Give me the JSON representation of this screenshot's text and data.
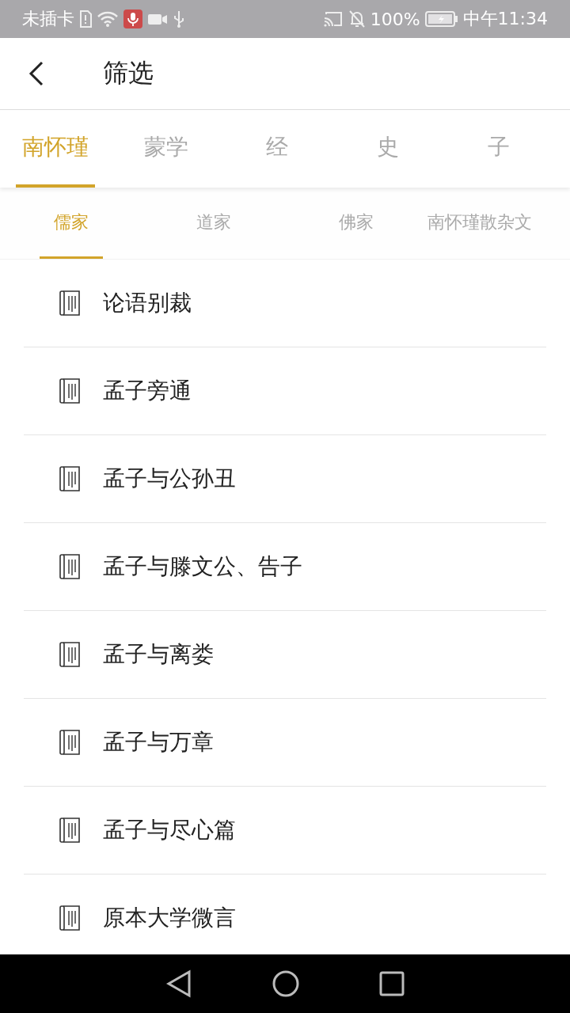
{
  "status_bar": {
    "carrier": "未插卡",
    "battery": "100%",
    "time": "中午11:34"
  },
  "header": {
    "title": "筛选"
  },
  "tabs": [
    {
      "label": "南怀瑾",
      "selected": true
    },
    {
      "label": "蒙学",
      "selected": false
    },
    {
      "label": "经",
      "selected": false
    },
    {
      "label": "史",
      "selected": false
    },
    {
      "label": "子",
      "selected": false
    }
  ],
  "subtabs": [
    {
      "label": "儒家",
      "selected": true
    },
    {
      "label": "道家",
      "selected": false
    },
    {
      "label": "佛家",
      "selected": false
    },
    {
      "label": "南怀瑾散杂文",
      "selected": false
    }
  ],
  "books": [
    {
      "title": "论语别裁"
    },
    {
      "title": "孟子旁通"
    },
    {
      "title": "孟子与公孙丑"
    },
    {
      "title": "孟子与滕文公、告子"
    },
    {
      "title": "孟子与离娄"
    },
    {
      "title": "孟子与万章"
    },
    {
      "title": "孟子与尽心篇"
    },
    {
      "title": "原本大学微言"
    }
  ]
}
